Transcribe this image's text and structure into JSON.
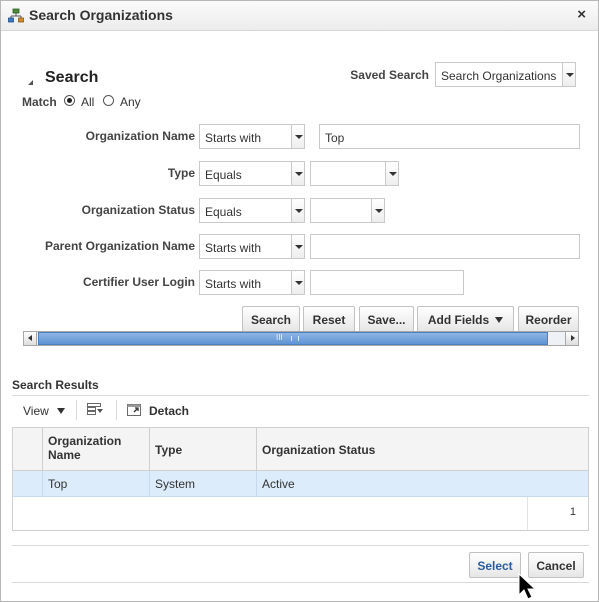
{
  "dialog": {
    "title": "Search Organizations",
    "close_glyph": "×",
    "icon": "organization-tree-icon"
  },
  "search": {
    "heading": "Search",
    "saved_search_label": "Saved Search",
    "saved_search_value": "Search Organizations",
    "match_label": "Match",
    "match_all": "All",
    "match_any": "Any",
    "match_selected": "All",
    "fields": [
      {
        "label": "Organization Name",
        "operator": "Starts with",
        "value": "Top"
      },
      {
        "label": "Type",
        "operator": "Equals",
        "value": ""
      },
      {
        "label": "Organization Status",
        "operator": "Equals",
        "value": ""
      },
      {
        "label": "Parent Organization Name",
        "operator": "Starts with",
        "value": ""
      },
      {
        "label": "Certifier User Login",
        "operator": "Starts with",
        "value": ""
      }
    ],
    "buttons": {
      "search": "Search",
      "reset": "Reset",
      "save": "Save...",
      "add_fields": "Add Fields",
      "reorder": "Reorder"
    },
    "scrollbar_grip": "III"
  },
  "results": {
    "title": "Search Results",
    "view_label": "View",
    "detach_label": "Detach",
    "columns": [
      "Organization Name",
      "Type",
      "Organization Status"
    ],
    "rows": [
      {
        "name": "Top",
        "type": "System",
        "status": "Active"
      }
    ],
    "row_count": "1"
  },
  "footer": {
    "select": "Select",
    "cancel": "Cancel"
  },
  "colors": {
    "selected_row": "#dcecfb",
    "scroll_thumb": "#5e93d2",
    "select_button_text": "#2a5d9f"
  }
}
